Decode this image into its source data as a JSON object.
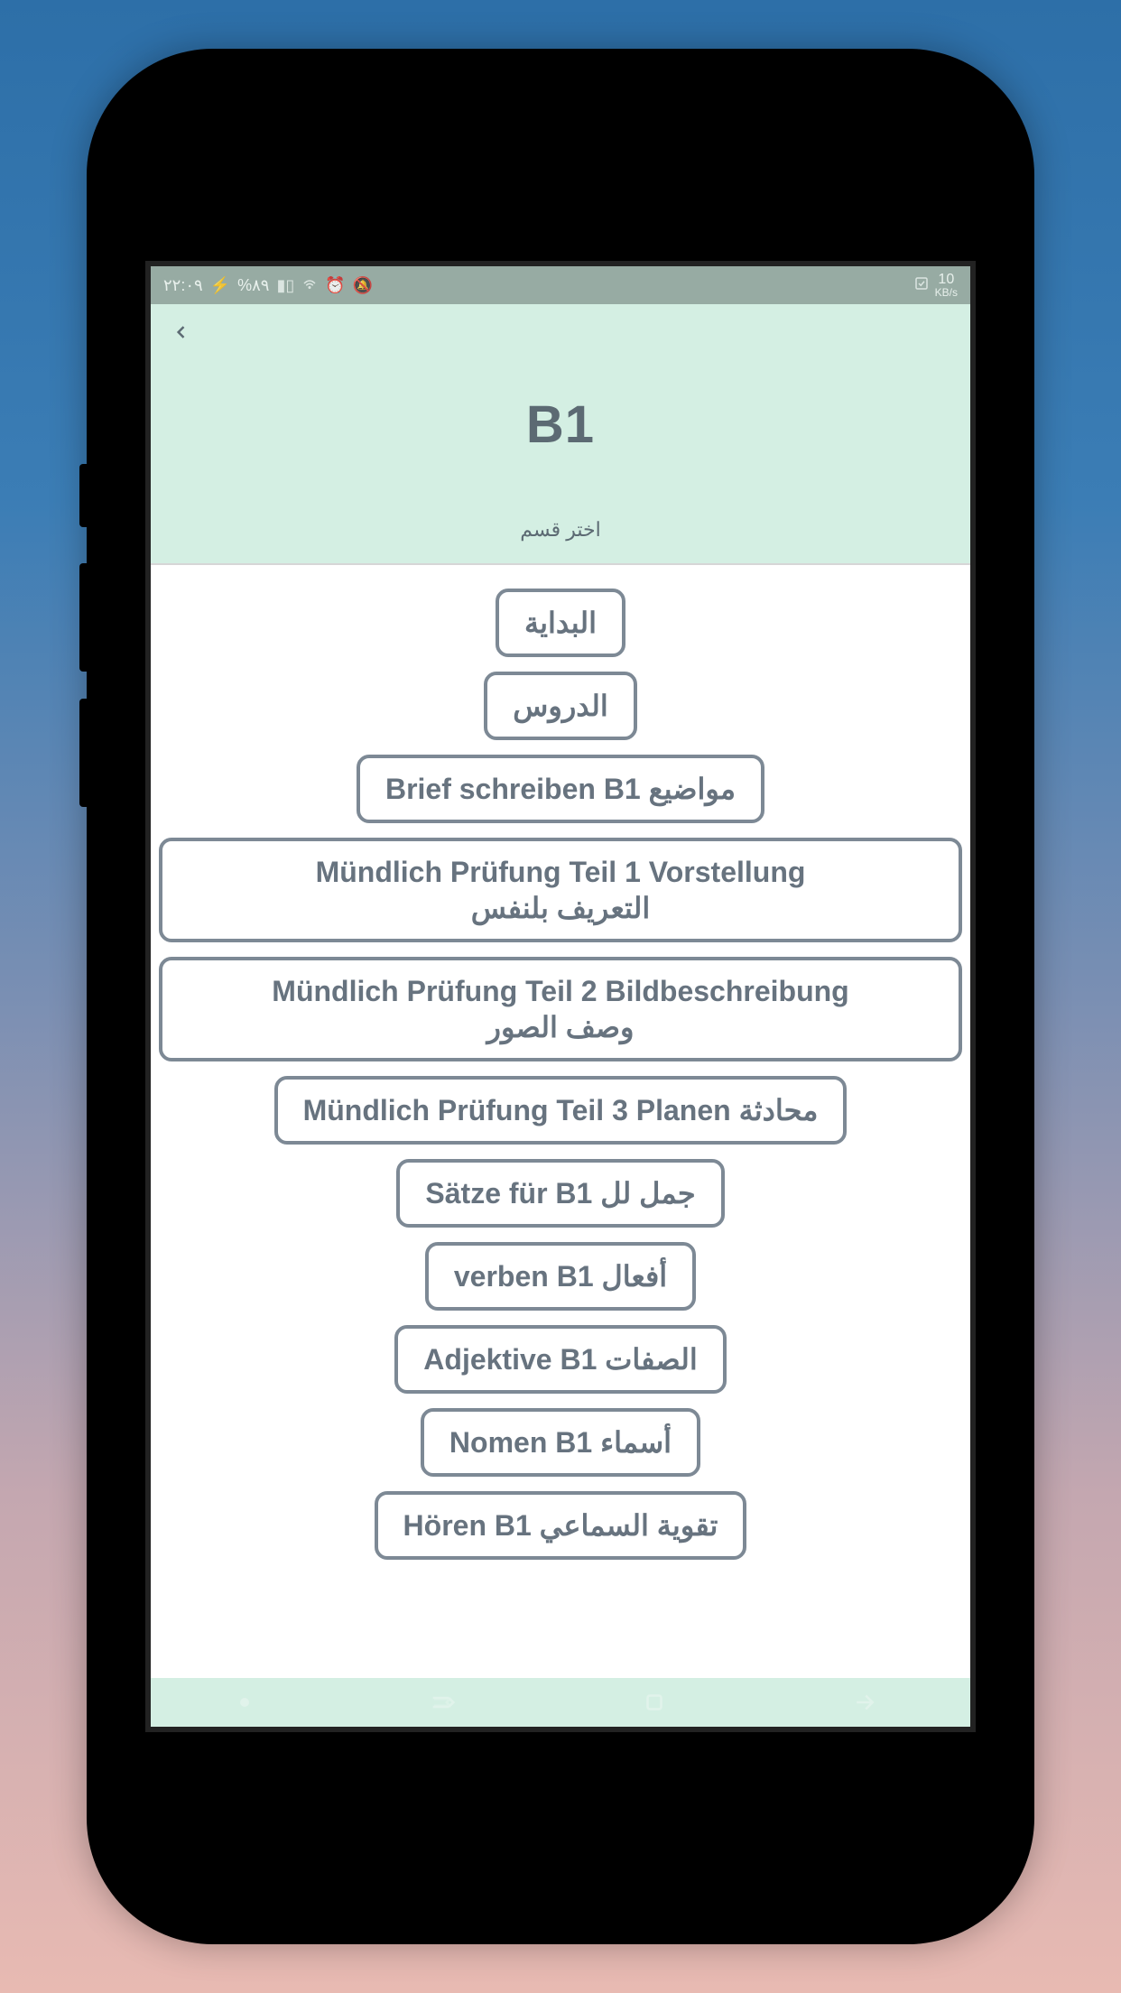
{
  "status": {
    "time": "٢٢:٠٩",
    "battery": "%٨٩",
    "data_rate_num": "10",
    "data_rate_unit": "KB/s"
  },
  "header": {
    "title": "B1",
    "subtitle": "اختر قسم"
  },
  "sections": [
    {
      "label": "البداية",
      "wide": false
    },
    {
      "label": "الدروس",
      "wide": false
    },
    {
      "label": "Brief schreiben B1 مواضيع",
      "wide": false
    },
    {
      "label": "Mündlich Prüfung Teil 1 Vorstellung\nالتعريف بلنفس",
      "wide": true
    },
    {
      "label": "Mündlich Prüfung Teil 2 Bildbeschreibung\nوصف الصور",
      "wide": true
    },
    {
      "label": "Mündlich Prüfung Teil 3 Planen محادثة",
      "wide": false
    },
    {
      "label": "Sätze für B1 جمل لل",
      "wide": false
    },
    {
      "label": "verben B1 أفعال",
      "wide": false
    },
    {
      "label": "Adjektive B1 الصفات",
      "wide": false
    },
    {
      "label": "Nomen B1 أسماء",
      "wide": false
    },
    {
      "label": "Hören B1 تقوية السماعي",
      "wide": false
    }
  ]
}
